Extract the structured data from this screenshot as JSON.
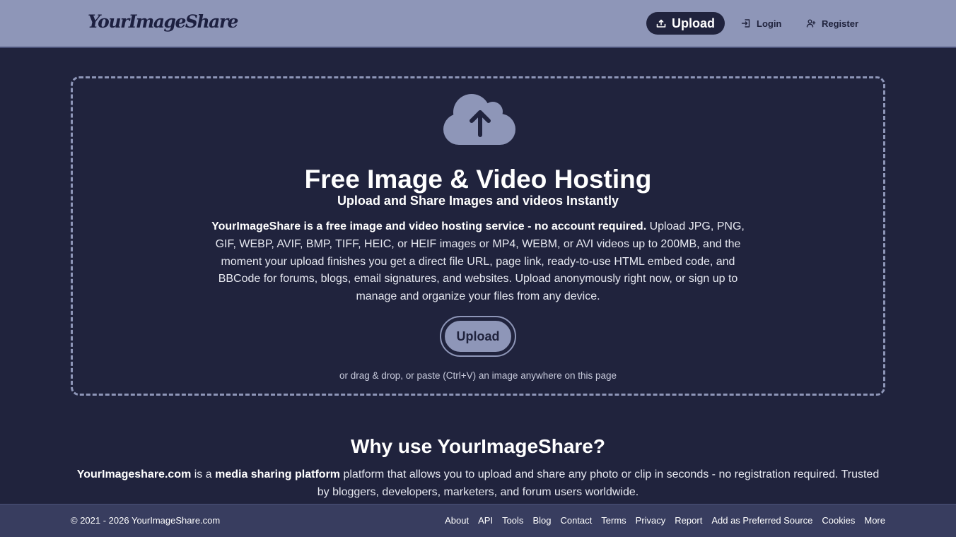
{
  "header": {
    "logo": "YourImageShare",
    "upload_label": "Upload",
    "login_label": "Login",
    "register_label": "Register",
    "icons": {
      "upload": "upload-tray-icon",
      "login": "login-icon",
      "register": "user-plus-icon"
    }
  },
  "hero": {
    "icon": "cloud-upload-icon",
    "title": "Free Image & Video Hosting",
    "subtitle": "Upload and Share Images and videos Instantly",
    "description_bold": "YourImageShare is a free image and video hosting service - no account required.",
    "description_rest": " Upload JPG, PNG, GIF, WEBP, AVIF, BMP, TIFF, HEIC, or HEIF images or MP4, WEBM, or AVI videos up to 200MB, and the moment your upload finishes you get a direct file URL, page link, ready-to-use HTML embed code, and BBCode for forums, blogs, email signatures, and websites. Upload anonymously right now, or sign up to manage and organize your files from any device.",
    "upload_button": "Upload",
    "drop_hint": "or drag & drop, or paste (Ctrl+V) an image anywhere on this page"
  },
  "why": {
    "title": "Why use YourImageShare?",
    "site_bold": "YourImageshare.com",
    "is_text": " is a ",
    "platform_bold": "media sharing platform",
    "rest": " platform that allows you to upload and share any photo or clip in seconds - no registration required. Trusted by bloggers, developers, marketers, and forum users worldwide."
  },
  "footer": {
    "copyright": "© 2021 - 2026 YourImageShare.com",
    "links": [
      "About",
      "API",
      "Tools",
      "Blog",
      "Contact",
      "Terms",
      "Privacy",
      "Report",
      "Add as Preferred Source",
      "Cookies",
      "More"
    ]
  },
  "colors": {
    "background": "#20233d",
    "header": "#8e96b8",
    "footer": "#383d5f",
    "accent": "#8e96b8"
  }
}
